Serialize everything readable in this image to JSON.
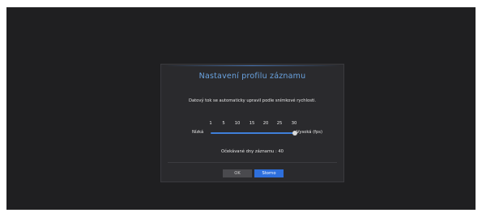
{
  "dialog": {
    "title": "Nastavení profilu záznamu",
    "message": "Datový tok se automaticky upravil podle snímkové rychlosti.",
    "slider": {
      "ticks": [
        "1",
        "5",
        "10",
        "15",
        "20",
        "25",
        "30"
      ],
      "low_label": "Nízká",
      "high_label": "Vysoká (fps)",
      "value_fraction": 1.0
    },
    "expected_days": "Očekávané dny záznamu : 40",
    "buttons": {
      "ok": "OK",
      "cancel": "Storno"
    }
  },
  "colors": {
    "accent": "#3f7fd9",
    "title": "#6aa3e0",
    "screen_bg": "#1f1f21",
    "dialog_bg": "#2a2a2d"
  }
}
